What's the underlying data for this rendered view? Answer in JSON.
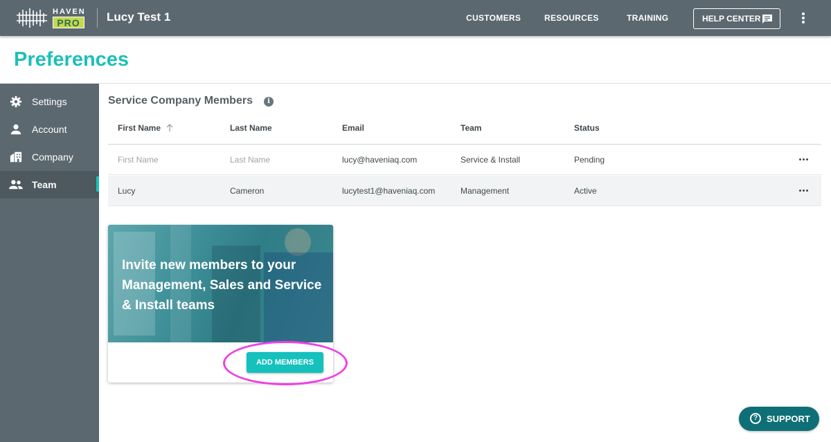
{
  "header": {
    "logo_top": "HAVEN",
    "logo_bottom": "PRO",
    "company": "Lucy Test 1",
    "nav": [
      "CUSTOMERS",
      "RESOURCES",
      "TRAINING"
    ],
    "help_center": "HELP CENTER"
  },
  "page": {
    "title": "Preferences"
  },
  "sidebar": {
    "items": [
      {
        "label": "Settings",
        "icon": "gear-icon"
      },
      {
        "label": "Account",
        "icon": "person-icon"
      },
      {
        "label": "Company",
        "icon": "building-icon"
      },
      {
        "label": "Team",
        "icon": "people-icon",
        "active": true
      }
    ]
  },
  "members": {
    "title": "Service Company Members",
    "info": "i",
    "columns": [
      "First Name",
      "Last Name",
      "Email",
      "Team",
      "Status"
    ],
    "rows": [
      {
        "first": "First Name",
        "last": "Last Name",
        "email": "lucy@haveniaq.com",
        "team": "Service & Install",
        "status": "Pending"
      },
      {
        "first": "Lucy",
        "last": "Cameron",
        "email": "lucytest1@haveniaq.com",
        "team": "Management",
        "status": "Active"
      }
    ]
  },
  "invite": {
    "text": "Invite new members to your Management, Sales and Service & Install teams",
    "button": "ADD MEMBERS"
  },
  "support": {
    "label": "SUPPORT"
  },
  "colors": {
    "accent": "#1dbfb9",
    "nav_bg": "#5c6870",
    "support_bg": "#0e6f77",
    "highlight": "#ee3fe6"
  }
}
